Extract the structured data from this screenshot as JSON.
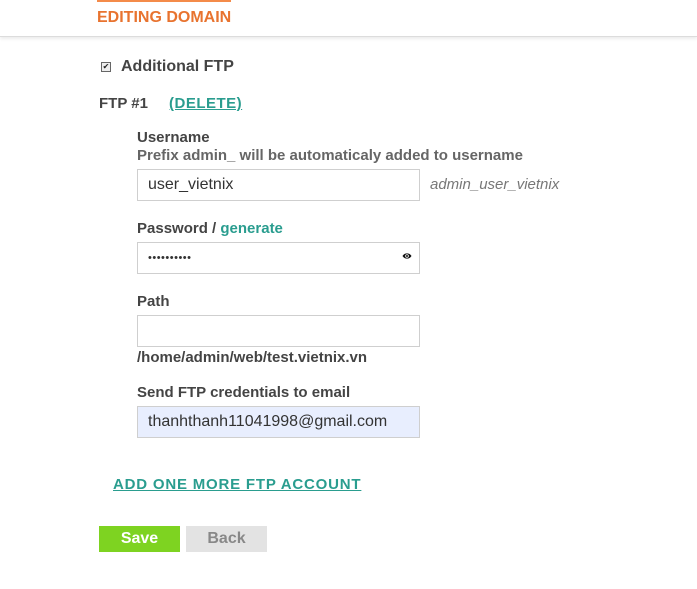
{
  "header": {
    "tab_title": "EDITING DOMAIN"
  },
  "additional_ftp": {
    "label": "Additional FTP",
    "checked": true
  },
  "ftp": {
    "title": "FTP #1",
    "delete_label": "(DELETE)",
    "username": {
      "label": "Username",
      "hint": "Prefix admin_ will be automaticaly added to username",
      "value": "user_vietnix",
      "full_username": "admin_user_vietnix"
    },
    "password": {
      "label": "Password / ",
      "generate_label": "generate",
      "masked_value": "••••••••••",
      "icon": "eye-icon"
    },
    "path": {
      "label": "Path",
      "value": "",
      "prefix": "/home/admin/web/test.vietnix.vn"
    },
    "email": {
      "label": "Send FTP credentials to email",
      "value": "thanhthanh11041998@gmail.com"
    }
  },
  "add_more_label": "ADD ONE MORE FTP ACCOUNT",
  "buttons": {
    "save": "Save",
    "back": "Back"
  },
  "colors": {
    "accent": "#e8732f",
    "link": "#2a9d8f",
    "save": "#7ed321"
  }
}
